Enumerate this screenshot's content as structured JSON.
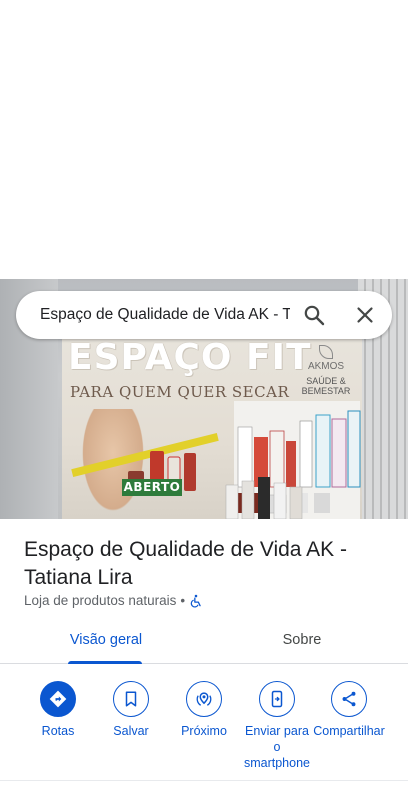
{
  "search": {
    "query": "Espaço de Qualidade de Vida AK - T"
  },
  "photo": {
    "poster_title": "ESPAÇO FIT",
    "poster_subtitle": "PARA QUEM QUER SECAR",
    "brand_name": "AKMOS",
    "brand_tagline": "SAÚDE & BEMESTAR",
    "open_sign": "ABERTO"
  },
  "place": {
    "title": "Espaço de Qualidade de Vida AK - Tatiana Lira",
    "category": "Loja de produtos naturais",
    "separator": "•"
  },
  "tabs": [
    {
      "label": "Visão geral",
      "active": true
    },
    {
      "label": "Sobre",
      "active": false
    }
  ],
  "actions": [
    {
      "label": "Rotas",
      "icon": "directions-icon"
    },
    {
      "label": "Salvar",
      "icon": "bookmark-icon"
    },
    {
      "label": "Próximo",
      "icon": "nearby-icon"
    },
    {
      "label": "Enviar para o smartphone",
      "icon": "send-to-phone-icon"
    },
    {
      "label": "Compartilhar",
      "icon": "share-icon"
    }
  ],
  "colors": {
    "accent": "#0b57d0",
    "text_primary": "#202124",
    "text_secondary": "#5f6368"
  }
}
